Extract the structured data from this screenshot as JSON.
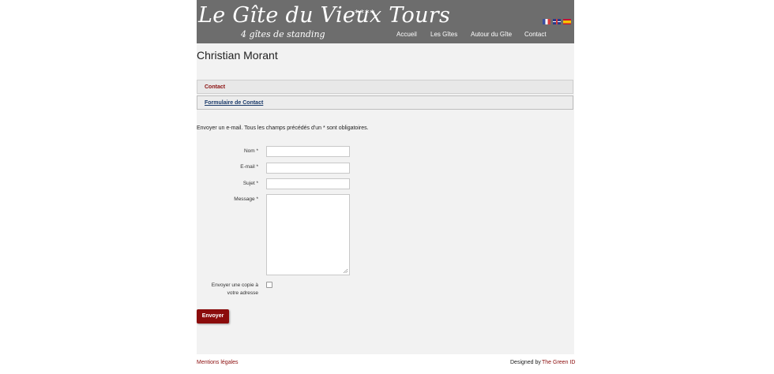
{
  "header": {
    "brand_title": "Le Gîte du Vieux Tours",
    "brand_stars": "****",
    "brand_subtitle": "4 gîtes de standing",
    "nav": [
      "Accueil",
      "Les Gîtes",
      "Autour du Gîte",
      "Contact"
    ],
    "flags": [
      "flag-fr-icon",
      "flag-uk-icon",
      "flag-es-icon"
    ]
  },
  "main": {
    "page_title": "Christian Morant",
    "tab_contact": "Contact",
    "tab_form": "Formulaire de Contact",
    "intro": "Envoyer un e-mail. Tous les champs précédés d'un * sont obligatoires.",
    "form": {
      "name_label": "Nom *",
      "email_label": "E-mail *",
      "subject_label": "Sujet *",
      "message_label": "Message *",
      "name_value": "",
      "email_value": "",
      "subject_value": "",
      "message_value": "",
      "copy_label_line1": "Envoyer une copie à",
      "copy_label_line2": "votre adresse",
      "copy_checked": false,
      "submit_label": "Envoyer"
    }
  },
  "footer": {
    "legal": "Mentions légales",
    "designed_by": "Designed by",
    "designer": "The Green ID"
  },
  "colors": {
    "header_bg": "#6d6d6d",
    "accent": "#8b0c0c",
    "content_bg": "#f2f2f2"
  }
}
